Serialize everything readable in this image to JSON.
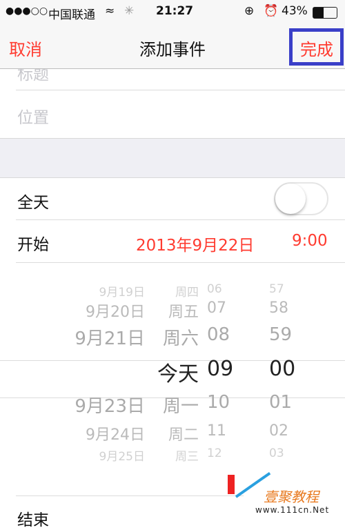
{
  "status_bar": {
    "signal": "●●●○○",
    "carrier": "中国联通",
    "time": "21:27",
    "battery": "43%",
    "battery_level": 0.43
  },
  "nav": {
    "cancel": "取消",
    "title": "添加事件",
    "done": "完成"
  },
  "form": {
    "title_placeholder": "标题",
    "location_placeholder": "位置",
    "all_day_label": "全天",
    "all_day_on": false,
    "start_label": "开始",
    "start_date": "2013年9月22日",
    "start_time": "9:00",
    "end_label": "结束"
  },
  "picker": {
    "rows": [
      {
        "date": "9月19日",
        "weekday": "周四",
        "hour": "06",
        "minute": "57"
      },
      {
        "date": "9月20日",
        "weekday": "周五",
        "hour": "07",
        "minute": "58"
      },
      {
        "date": "9月21日",
        "weekday": "周六",
        "hour": "08",
        "minute": "59"
      },
      {
        "date": "",
        "weekday": "今天",
        "hour": "09",
        "minute": "00"
      },
      {
        "date": "9月23日",
        "weekday": "周一",
        "hour": "10",
        "minute": "01"
      },
      {
        "date": "9月24日",
        "weekday": "周二",
        "hour": "11",
        "minute": "02"
      },
      {
        "date": "9月25日",
        "weekday": "周三",
        "hour": "12",
        "minute": "03"
      }
    ]
  },
  "watermark": {
    "name": "壹聚教程",
    "url": "www.111cn.Net"
  },
  "colors": {
    "accent": "#ff3b30",
    "highlight_box": "#3a3fc8"
  }
}
